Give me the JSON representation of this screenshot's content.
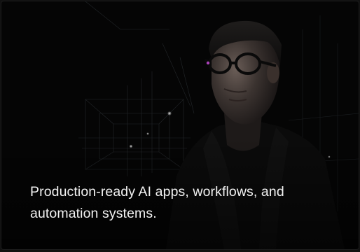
{
  "hero": {
    "image_subject": "portrait-of-man-with-glasses",
    "background": "#050505",
    "caption": "Production-ready AI apps, workflows, and automation systems."
  },
  "colors": {
    "card_background": "#050505",
    "caption_text": "#f2f2f2"
  }
}
